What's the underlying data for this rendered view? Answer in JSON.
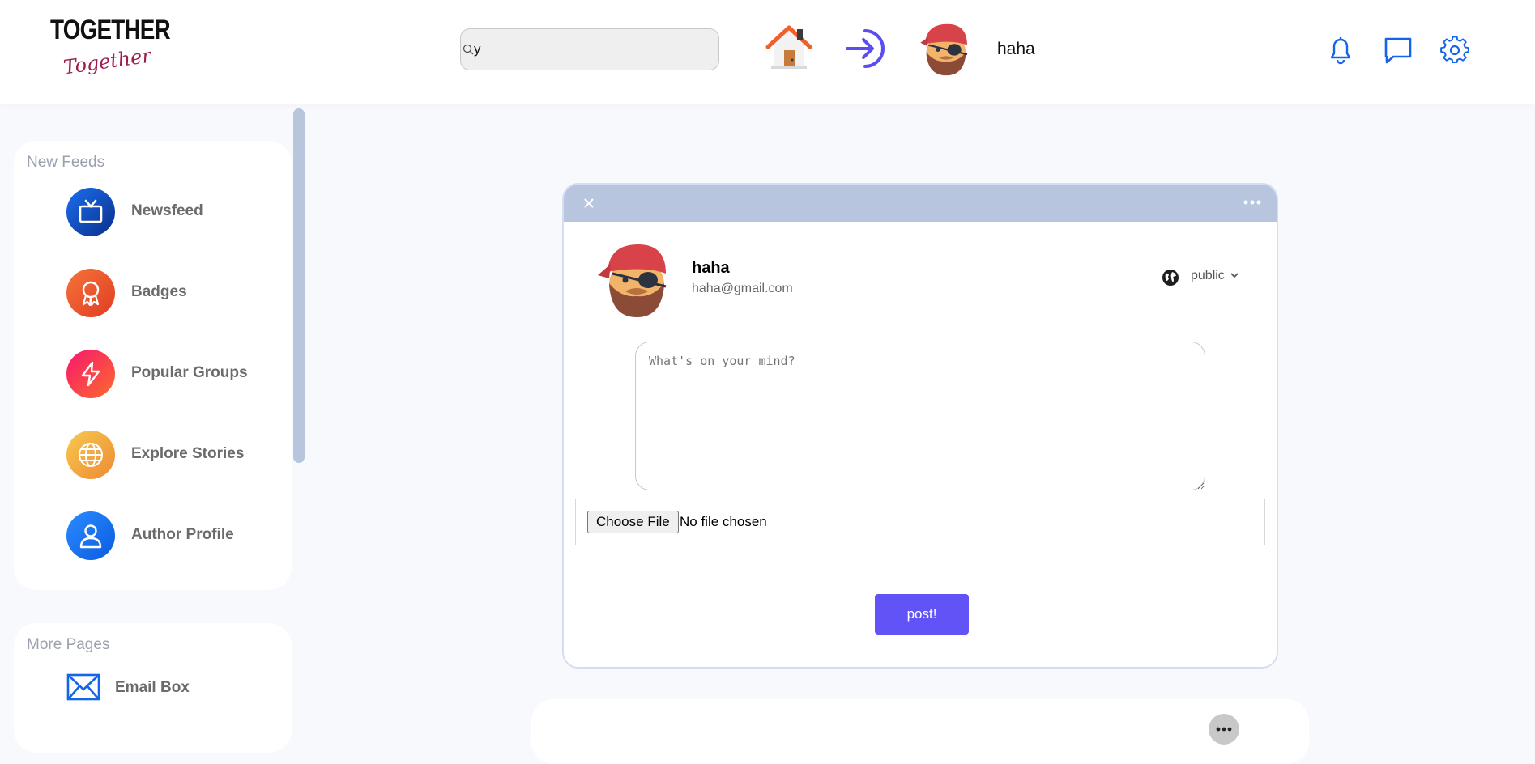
{
  "header": {
    "logo_main": "TOGETHER",
    "logo_script": "Together",
    "search_value": "y",
    "username": "haha"
  },
  "sidebar": {
    "section1_title": "New Feeds",
    "items": [
      {
        "label": "Newsfeed",
        "icon": "tv-icon",
        "color": "#0b3fa8"
      },
      {
        "label": "Badges",
        "icon": "badge-icon",
        "color": "#ea4f2a"
      },
      {
        "label": "Popular Groups",
        "icon": "lightning-icon",
        "color": "#f3286a"
      },
      {
        "label": "Explore Stories",
        "icon": "globe-icon",
        "color": "#f2ad3d"
      },
      {
        "label": "Author Profile",
        "icon": "user-icon",
        "color": "#1e74f0"
      }
    ],
    "section2_title": "More Pages",
    "more_items": [
      {
        "label": "Email Box",
        "icon": "mail-icon"
      }
    ]
  },
  "modal": {
    "name": "haha",
    "email": "haha@gmail.com",
    "privacy": "public",
    "textarea_placeholder": "What's on your mind?",
    "file_button": "Choose File",
    "file_status": "No file chosen",
    "post_button": "post!"
  },
  "colors": {
    "accent": "#6253f7",
    "modal_bar": "#b7c5df",
    "icon_blue": "#1565e8"
  }
}
